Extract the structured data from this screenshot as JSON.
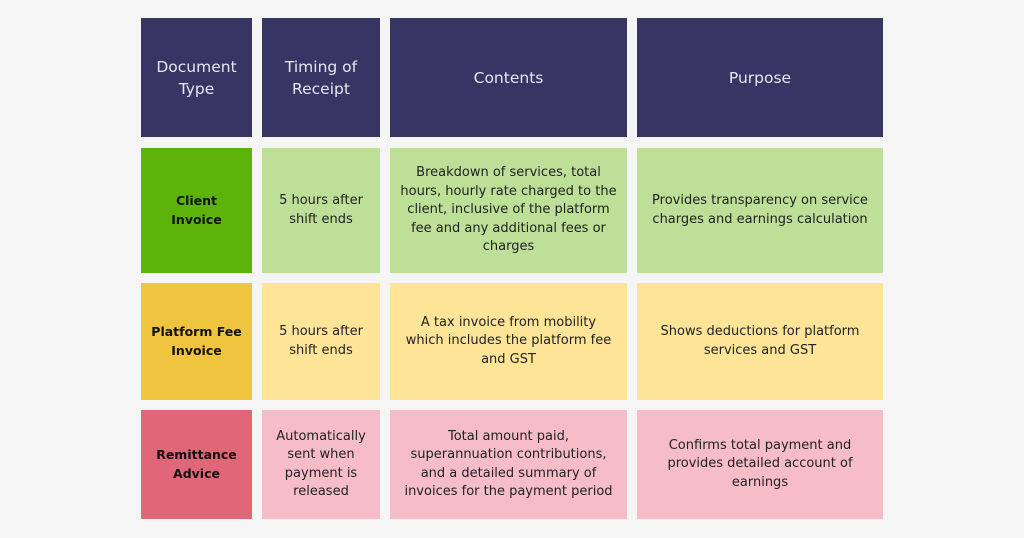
{
  "colors": {
    "header_bg": "#373563",
    "client_invoice_dark": "#5db30a",
    "client_invoice_light": "#bddf97",
    "platform_fee_dark": "#efc43f",
    "platform_fee_light": "#fde497",
    "remittance_dark": "#e06778",
    "remittance_light": "#f6bcc8",
    "page_bg": "#f5f5f5"
  },
  "table": {
    "headers": [
      "Document Type",
      "Timing of Receipt",
      "Contents",
      "Purpose"
    ],
    "rows": [
      {
        "type": "Client Invoice",
        "timing": "5 hours after shift ends",
        "contents": "Breakdown of services, total hours, hourly rate charged to the client, inclusive of the platform fee and any additional fees or charges",
        "purpose": "Provides transparency on service charges and earnings calculation"
      },
      {
        "type": "Platform Fee Invoice",
        "timing": "5 hours after shift ends",
        "contents": "A tax invoice from mobility which includes the platform fee and GST",
        "purpose": "Shows deductions for platform services and GST"
      },
      {
        "type": "Remittance Advice",
        "timing": "Automatically sent when payment is released",
        "contents": "Total amount paid, superannuation contributions, and a detailed summary of invoices for the payment period",
        "purpose": "Confirms total payment and provides detailed account of earnings"
      }
    ]
  }
}
